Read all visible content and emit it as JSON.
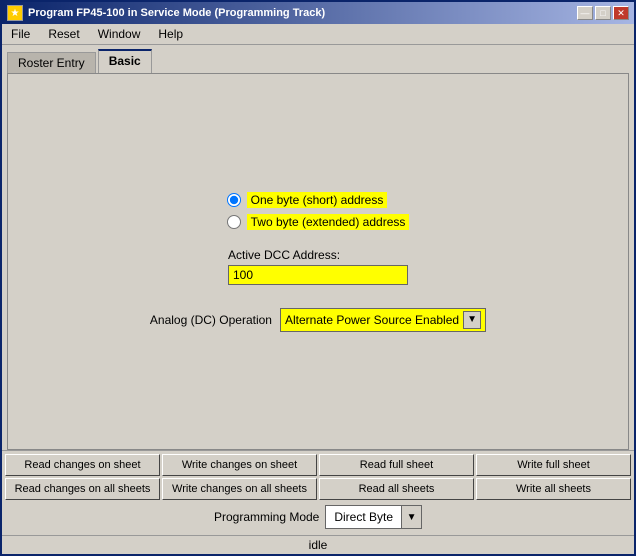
{
  "window": {
    "title": "Program FP45-100 in Service Mode (Programming Track)",
    "icon": "★"
  },
  "menu": {
    "items": [
      "File",
      "Reset",
      "Window",
      "Help"
    ]
  },
  "tabs": [
    {
      "label": "Roster Entry",
      "active": false
    },
    {
      "label": "Basic",
      "active": true
    }
  ],
  "radio_group": {
    "option1": {
      "label": "One byte (short) address",
      "checked": true
    },
    "option2": {
      "label": "Two byte (extended) address",
      "checked": false
    }
  },
  "dcc": {
    "label": "Active DCC Address:",
    "value": "100"
  },
  "analog": {
    "label": "Analog (DC) Operation",
    "value": "Alternate Power Source Enabled"
  },
  "buttons_row1": [
    "Read changes on sheet",
    "Write changes on sheet",
    "Read full sheet",
    "Write full sheet"
  ],
  "buttons_row2": [
    "Read changes on all sheets",
    "Write changes on all sheets",
    "Read all sheets",
    "Write all sheets"
  ],
  "programming": {
    "label": "Programming Mode",
    "value": "Direct Byte"
  },
  "status": {
    "text": "idle"
  },
  "title_buttons": {
    "minimize": "—",
    "maximize": "□",
    "close": "✕"
  }
}
